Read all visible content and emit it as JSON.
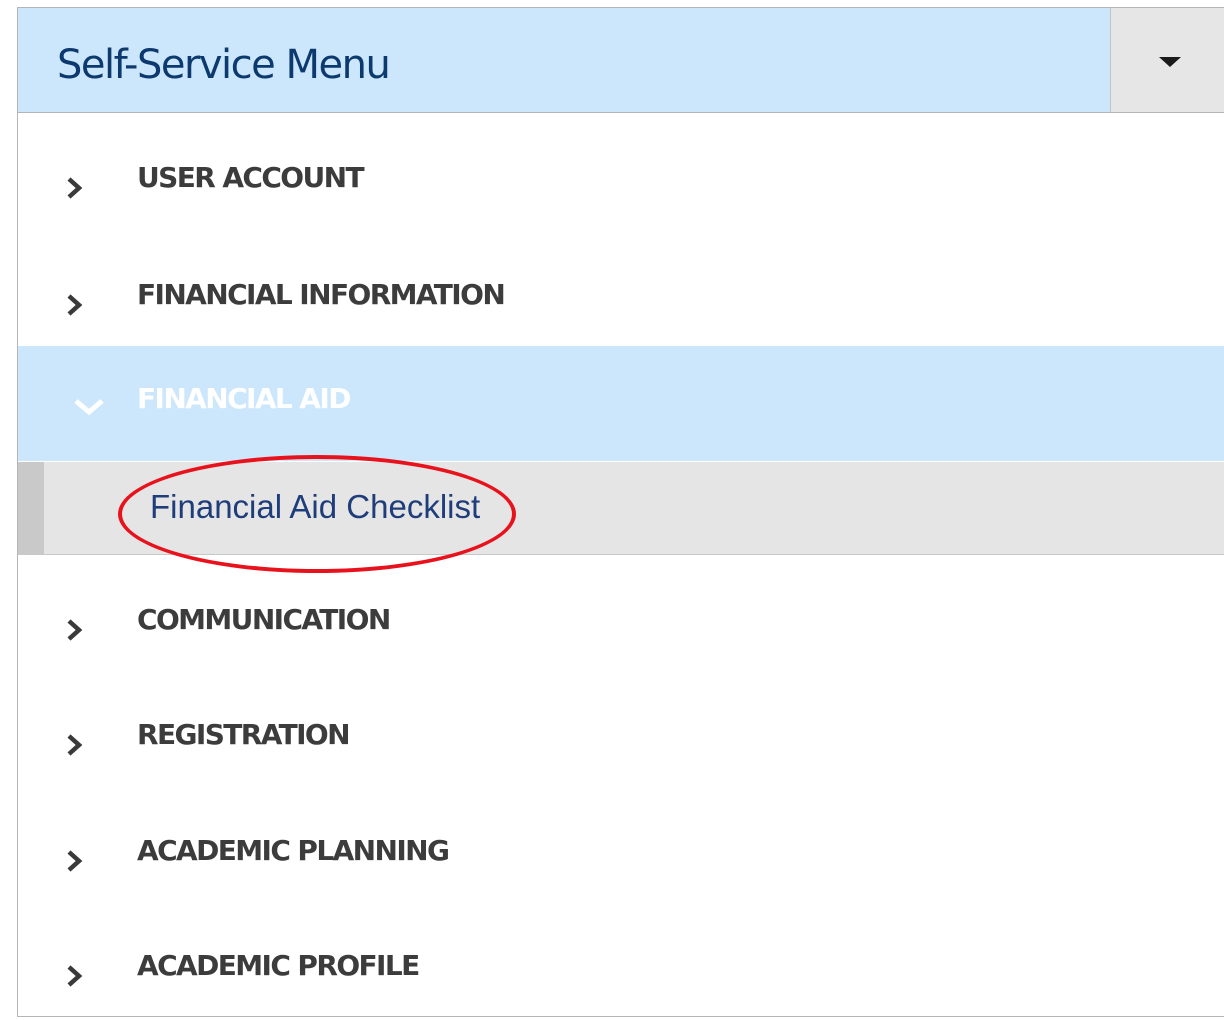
{
  "menu": {
    "title": "Self-Service Menu",
    "toggle_icon": "caret-down-icon",
    "items": [
      {
        "label": "USER ACCOUNT",
        "state": "collapsed"
      },
      {
        "label": "FINANCIAL INFORMATION",
        "state": "collapsed"
      },
      {
        "label": "FINANCIAL AID",
        "state": "expanded",
        "children": [
          {
            "label": "Financial Aid Checklist"
          }
        ]
      },
      {
        "label": "COMMUNICATION",
        "state": "collapsed"
      },
      {
        "label": "REGISTRATION",
        "state": "collapsed"
      },
      {
        "label": "ACADEMIC PLANNING",
        "state": "collapsed"
      },
      {
        "label": "ACADEMIC PROFILE",
        "state": "collapsed"
      }
    ]
  },
  "colors": {
    "header_bg": "#cce7fc",
    "title_text": "#0c3a6e",
    "item_text": "#3c3c3c",
    "expanded_bg": "#cce7fc",
    "submenu_bg": "#e5e5e5",
    "link_text": "#1f3d7a",
    "annotation_circle": "#e8121c"
  },
  "annotation": {
    "shape": "ellipse",
    "target": "Financial Aid Checklist"
  }
}
